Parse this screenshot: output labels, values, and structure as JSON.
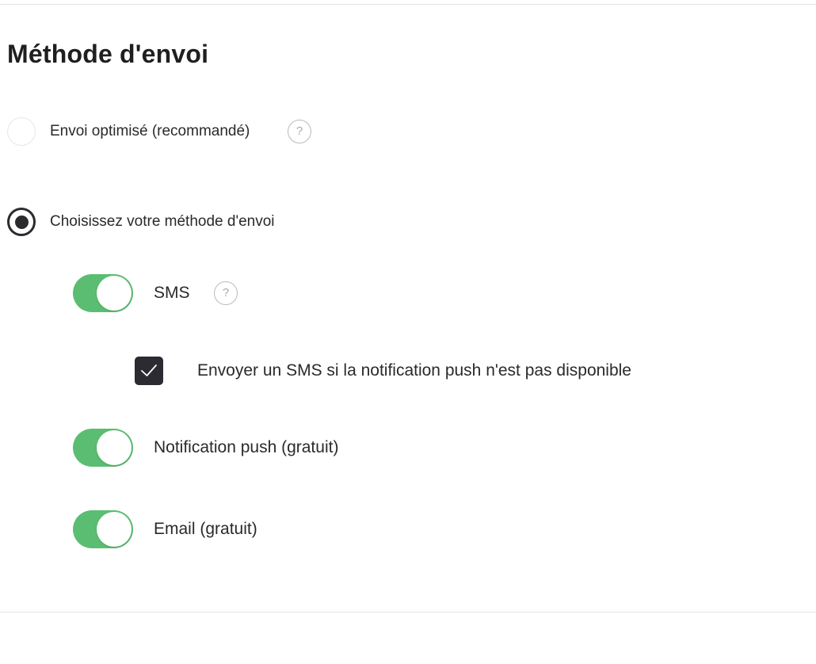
{
  "section": {
    "title": "Méthode d'envoi"
  },
  "delivery": {
    "options": [
      {
        "label": "Envoi optimisé (recommandé)",
        "selected": false,
        "help_icon": "question-circle-icon"
      },
      {
        "label": "Choisissez votre méthode d'envoi",
        "selected": true
      }
    ]
  },
  "channels": {
    "sms": {
      "label": "SMS",
      "enabled": true,
      "help_icon": "question-circle-icon",
      "fallback": {
        "label": "Envoyer un SMS si la notification push n'est pas disponible",
        "checked": true
      }
    },
    "push": {
      "label": "Notification push (gratuit)",
      "enabled": true
    },
    "email": {
      "label": "Email (gratuit)",
      "enabled": true
    }
  },
  "icons": {
    "help_glyph": "?"
  },
  "colors": {
    "toggle_on": "#5bbd72",
    "radio_checked": "#2b2b2f",
    "checkbox_checked": "#2b2b31",
    "help_icon": "#b9b9b9"
  }
}
